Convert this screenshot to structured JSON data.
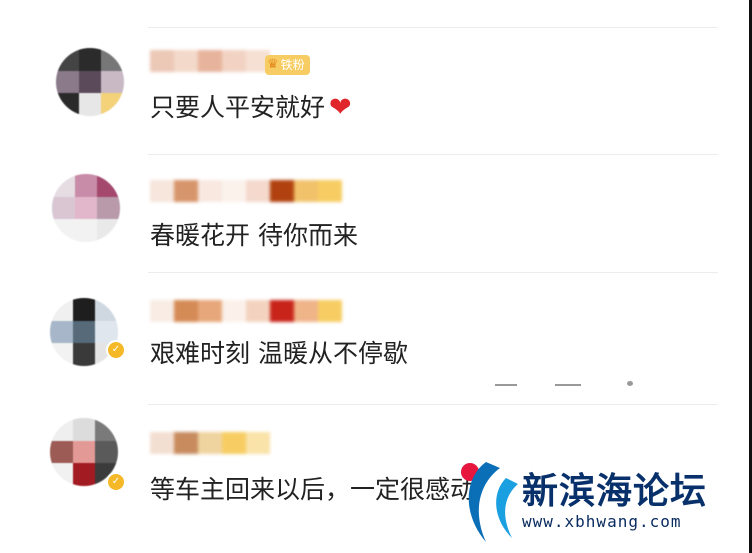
{
  "comments": [
    {
      "text": "只要人平安就好",
      "badge": "铁粉",
      "has_heart": true
    },
    {
      "text": "春暖花开 待你而来"
    },
    {
      "text": "艰难时刻 温暖从不停歇"
    },
    {
      "text": "等车主回来以后，一定很感动"
    }
  ],
  "verified_mark": "✓",
  "watermark": {
    "title": "新滨海论坛",
    "url": "www.xbhwang.com"
  },
  "colors": {
    "heart": "#e0262b",
    "badge": "#f7cd63",
    "watermark": "#08306b"
  },
  "icons": [
    "heart-icon",
    "crown-icon",
    "verified-icon",
    "logo-icon"
  ]
}
